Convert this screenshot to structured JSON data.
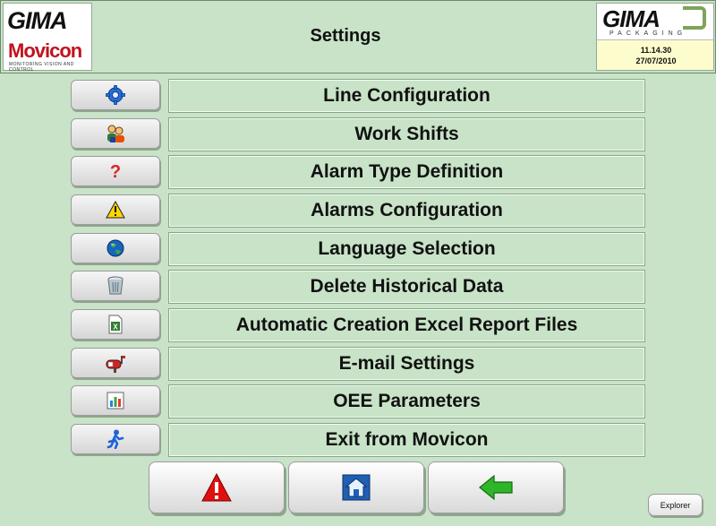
{
  "header": {
    "title": "Settings",
    "logo_left_brand": "GIMA",
    "logo_left_product": "Movicon",
    "logo_left_tagline": "MONITORING VISION AND CONTROL",
    "logo_right_brand": "GIMA",
    "logo_right_sub": "PACKAGING",
    "time": "11.14.30",
    "date": "27/07/2010"
  },
  "menu": {
    "items": [
      {
        "label": "Line Configuration",
        "icon": "gear-icon"
      },
      {
        "label": "Work Shifts",
        "icon": "users-icon"
      },
      {
        "label": "Alarm Type Definition",
        "icon": "question-icon"
      },
      {
        "label": "Alarms Configuration",
        "icon": "warning-icon"
      },
      {
        "label": "Language Selection",
        "icon": "globe-icon"
      },
      {
        "label": "Delete Historical Data",
        "icon": "trash-icon"
      },
      {
        "label": "Automatic Creation Excel Report Files",
        "icon": "excel-icon"
      },
      {
        "label": "E-mail Settings",
        "icon": "mailbox-icon"
      },
      {
        "label": "OEE Parameters",
        "icon": "chart-icon"
      },
      {
        "label": "Exit from Movicon",
        "icon": "exit-runner-icon"
      }
    ]
  },
  "bottom": {
    "alarm_icon": "alarm-triangle-icon",
    "home_icon": "home-icon",
    "back_icon": "back-arrow-icon",
    "explorer_label": "Explorer"
  },
  "colors": {
    "background": "#c8e3c7",
    "date_box": "#fdfccd",
    "brand_red": "#c1121f",
    "alarm_red": "#e01010",
    "arrow_green": "#2fb52a"
  }
}
